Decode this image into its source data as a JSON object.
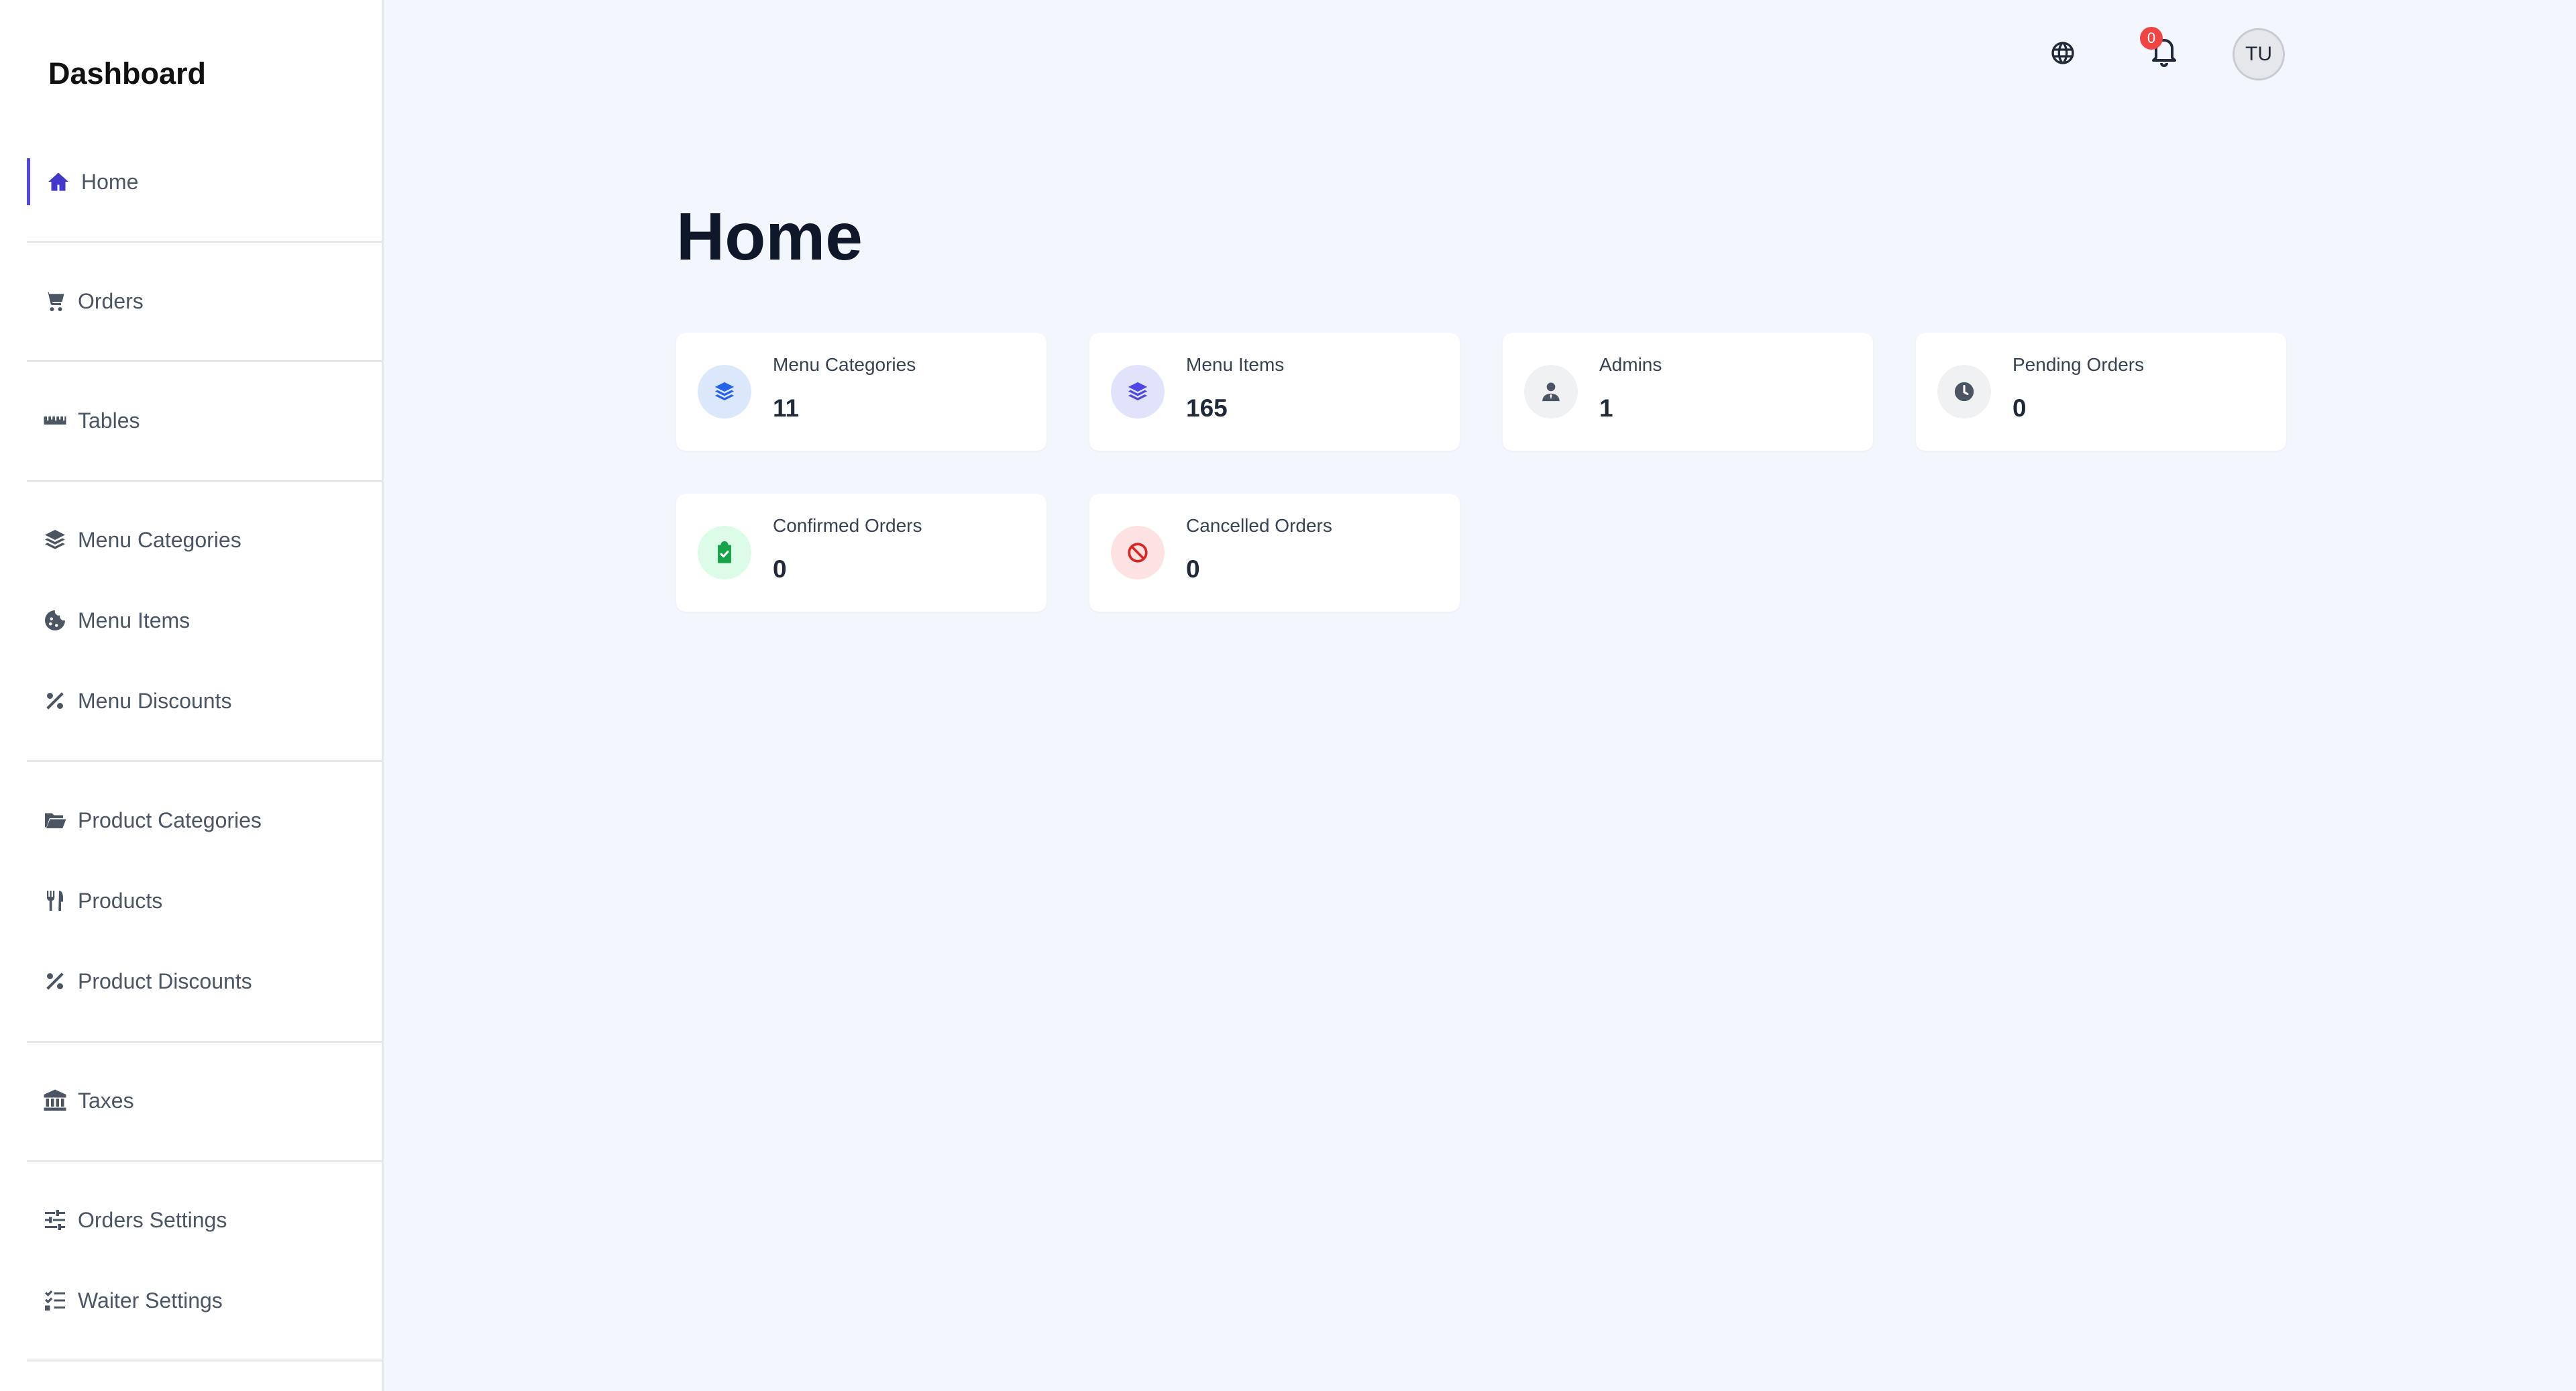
{
  "sidebar": {
    "brand": "Dashboard",
    "items": [
      {
        "label": "Home",
        "icon": "home-icon"
      },
      {
        "label": "Orders",
        "icon": "cart-icon"
      },
      {
        "label": "Tables",
        "icon": "ruler-icon"
      },
      {
        "label": "Menu Categories",
        "icon": "layers-icon"
      },
      {
        "label": "Menu Items",
        "icon": "cookie-icon"
      },
      {
        "label": "Menu Discounts",
        "icon": "percent-icon"
      },
      {
        "label": "Product Categories",
        "icon": "folder-open-icon"
      },
      {
        "label": "Products",
        "icon": "utensils-icon"
      },
      {
        "label": "Product Discounts",
        "icon": "percent-icon"
      },
      {
        "label": "Taxes",
        "icon": "bank-icon"
      },
      {
        "label": "Orders Settings",
        "icon": "sliders-icon"
      },
      {
        "label": "Waiter Settings",
        "icon": "checklist-icon"
      }
    ]
  },
  "header": {
    "notification_count": "0",
    "avatar_initials": "TU"
  },
  "main": {
    "title": "Home",
    "cards": [
      {
        "label": "Menu Categories",
        "value": "11",
        "icon": "layers-icon",
        "icon_color": "#2563eb",
        "icon_bg": "#dbe7fb"
      },
      {
        "label": "Menu Items",
        "value": "165",
        "icon": "layers-icon",
        "icon_color": "#4f46e5",
        "icon_bg": "#e0e3fa"
      },
      {
        "label": "Admins",
        "value": "1",
        "icon": "user-tie-icon",
        "icon_color": "#4b5563",
        "icon_bg": "#f0f1f3"
      },
      {
        "label": "Pending Orders",
        "value": "0",
        "icon": "clock-icon",
        "icon_color": "#4b5563",
        "icon_bg": "#f0f1f3"
      },
      {
        "label": "Confirmed Orders",
        "value": "0",
        "icon": "clipboard-check-icon",
        "icon_color": "#16a34a",
        "icon_bg": "#dcfce7"
      },
      {
        "label": "Cancelled Orders",
        "value": "0",
        "icon": "ban-icon",
        "icon_color": "#dc2626",
        "icon_bg": "#fde2e2"
      }
    ]
  },
  "colors": {
    "accent": "#4f46e5",
    "background": "#f3f6fc",
    "badge": "#ef4444"
  }
}
